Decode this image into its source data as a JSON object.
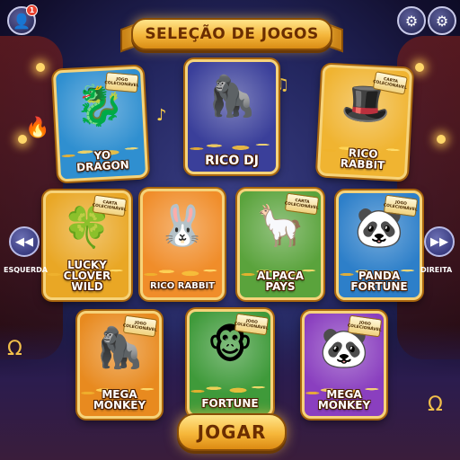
{
  "header": {
    "title": "SELEÇÃO DE JOGOS",
    "profile_icon": "user-icon",
    "notification_count": "1",
    "settings_icon_left": "gear-icon",
    "settings_icon_right": "gear-icon"
  },
  "navigation": {
    "left_label": "ESQUERDA",
    "right_label": "DIREITA",
    "left_icon": "rewind-icon",
    "right_icon": "fast-forward-icon",
    "left_glyph": "◀◀",
    "right_glyph": "▶▶"
  },
  "badge_text": "JOGO\nCOLECIONÁVEL",
  "cards": [
    {
      "name": "YO\nDRAGON",
      "art": "🐉",
      "badge": "JOGO\nCOLECIONÁVEL",
      "bg": "#2f8fd0"
    },
    {
      "name": "RICO  DJ",
      "art": "🦍",
      "badge": "",
      "bg": "#3a3f9a"
    },
    {
      "name": "RICO\nRABBIT",
      "art": "🎩",
      "badge": "CARTA\nCOLECIONÁVEL",
      "bg": "#f0b431"
    },
    {
      "name": "LUCKY\nCLOVER\nWILD",
      "art": "🍀",
      "badge": "CARTA\nCOLECIONÁVEL",
      "bg": "#e9a725"
    },
    {
      "name": "RICO RABBIT",
      "art": "🐰",
      "badge": "",
      "bg": "#f08d2a"
    },
    {
      "name": "ALPACA\nPAYS",
      "art": "🦙",
      "badge": "CARTA\nCOLECIONÁVEL",
      "bg": "#5aa33c"
    },
    {
      "name": "PANDA\nFORTUNE",
      "art": "🐼",
      "badge": "JOGO\nCOLECIONÁVEL",
      "bg": "#2d7fc9"
    },
    {
      "name": "MEGA\nMONKEY",
      "art": "🦍",
      "badge": "JOGO\nCOLECIONÁVEL",
      "bg": "#e88a1f"
    },
    {
      "name": "FORTUNE",
      "art": "🐵",
      "badge": "JOGO\nCOLECIONÁVEL",
      "bg": "#3f9a3a"
    },
    {
      "name": "MEGA\nMONKEY",
      "art": "🐼",
      "badge": "JOGO\nCOLECIONÁVEL",
      "bg": "#8a3fbf"
    }
  ],
  "play_button": {
    "label": "JOGAR"
  },
  "colors": {
    "gold": "#f6b73a",
    "banner_text": "#6a2d00",
    "background": "#23265e"
  }
}
